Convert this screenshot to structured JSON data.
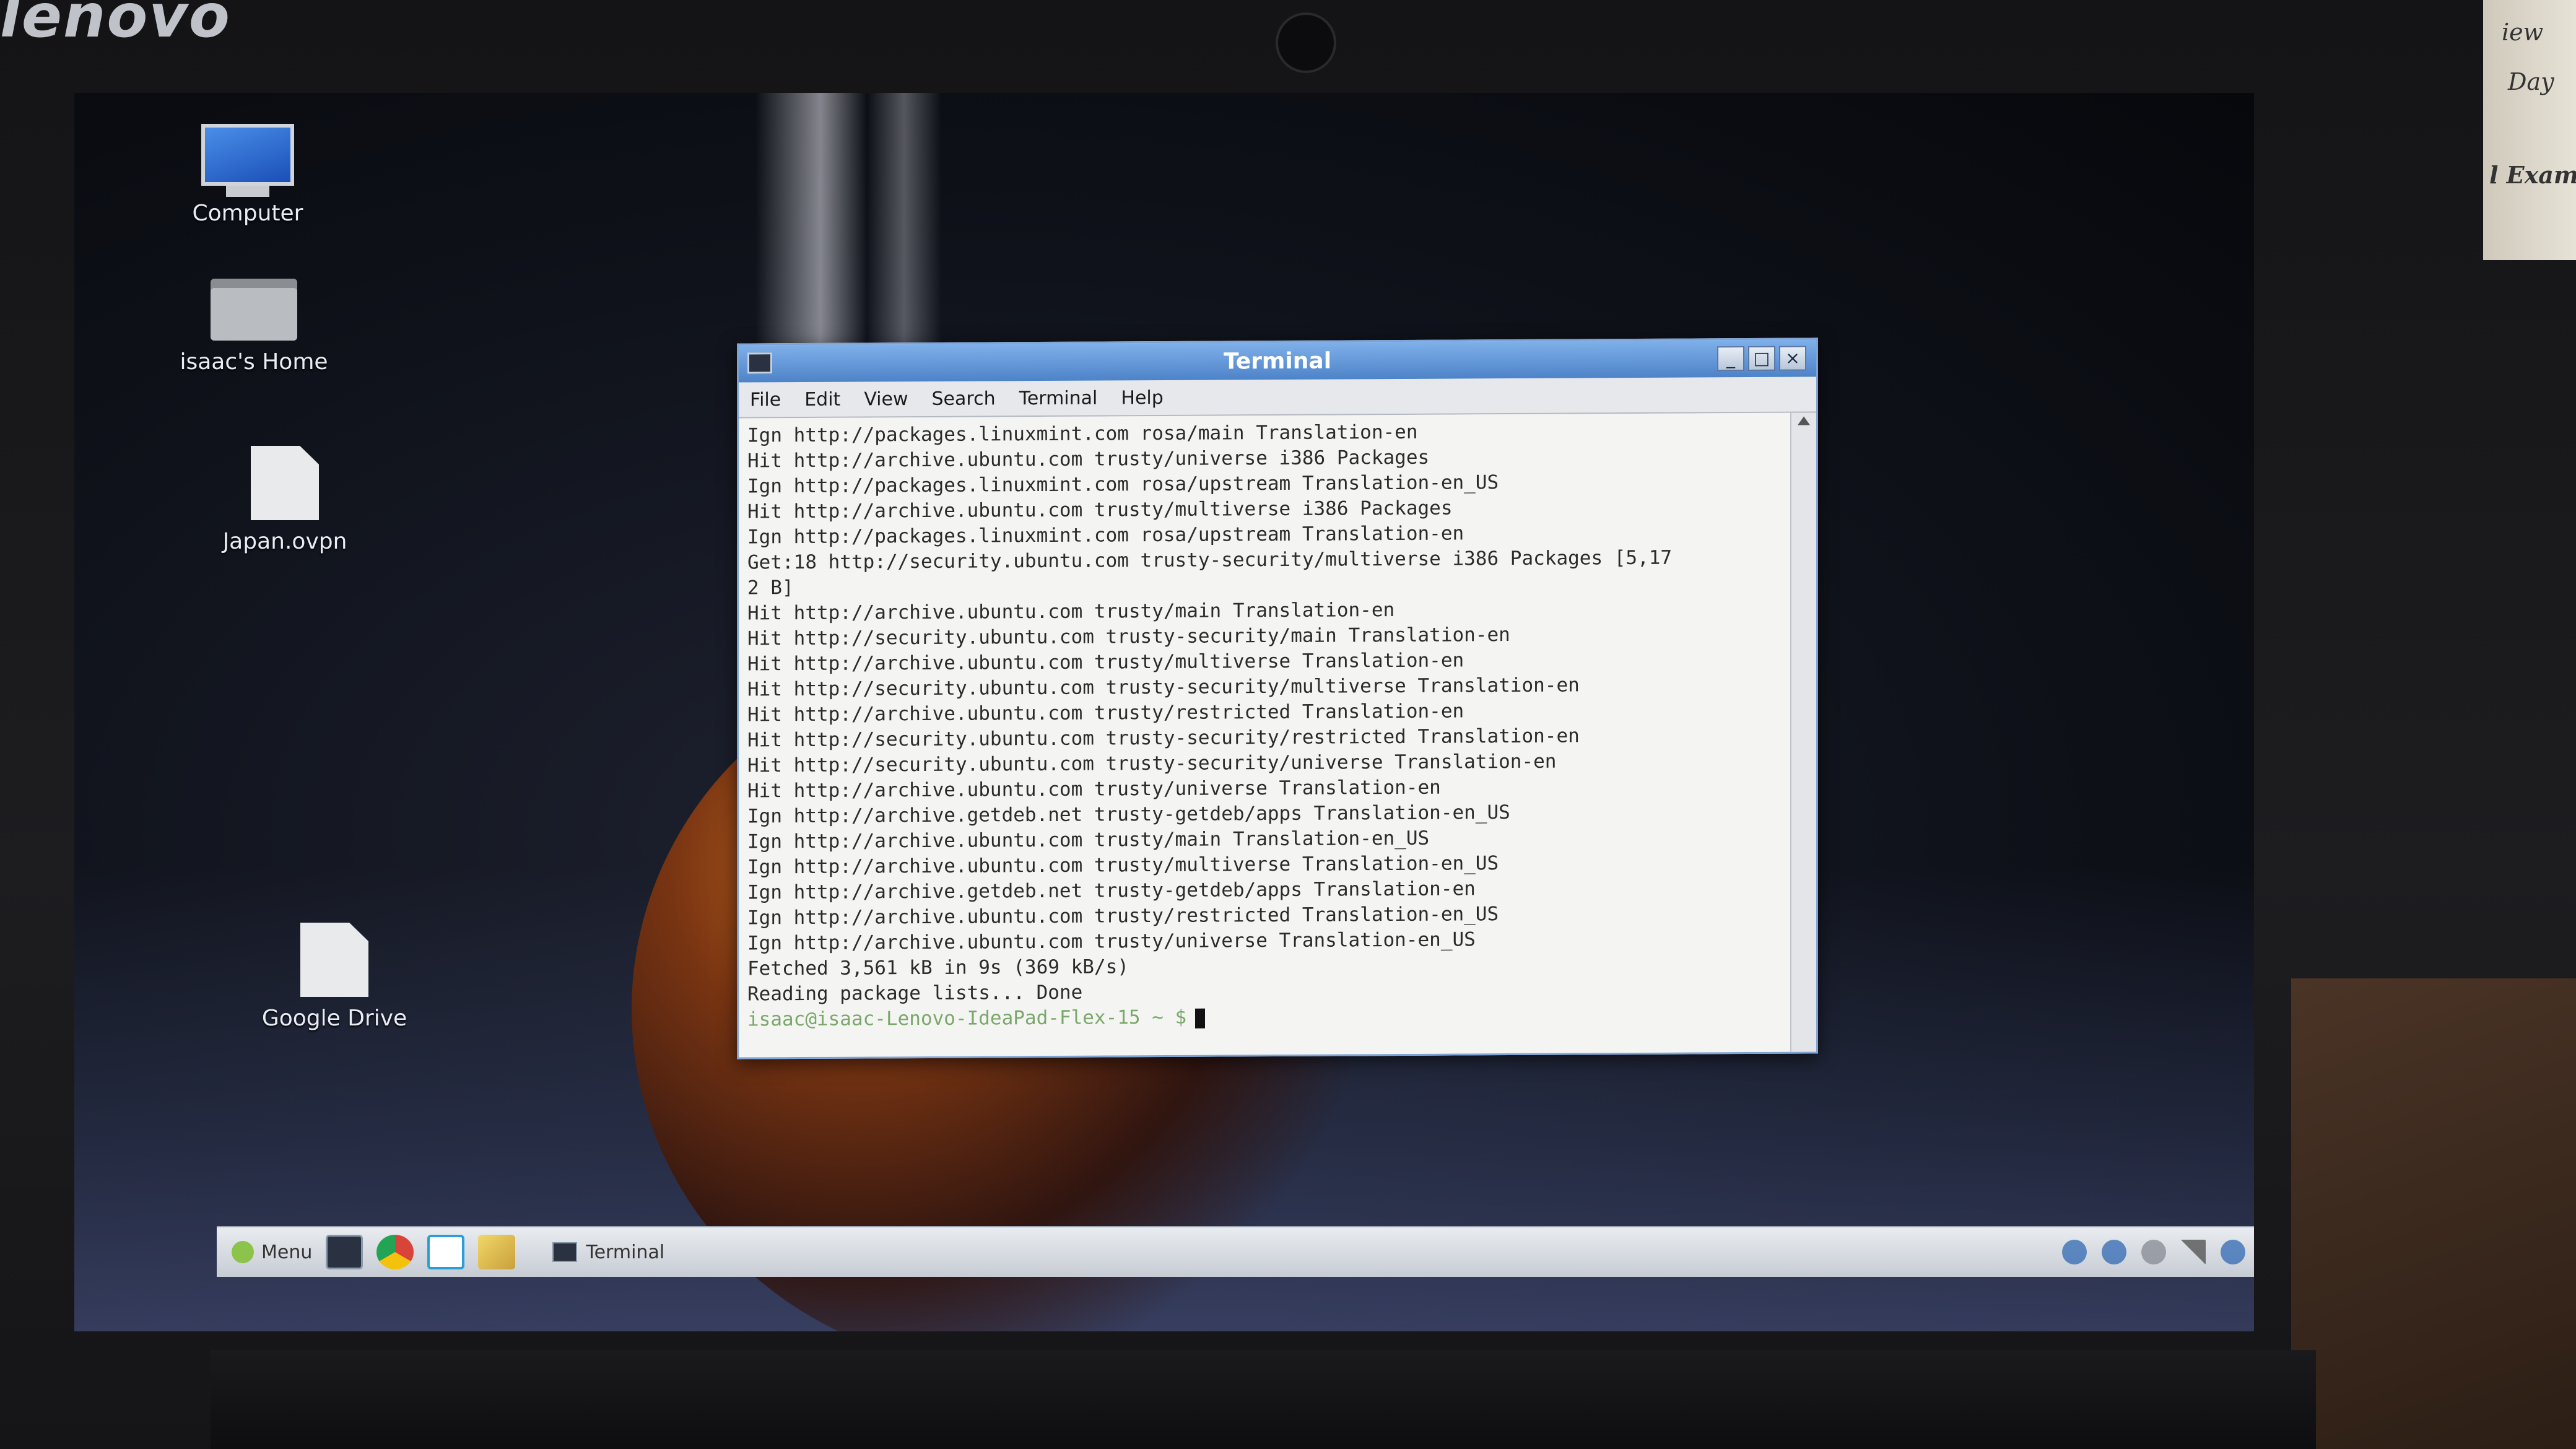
{
  "device": {
    "brand": "lenovo"
  },
  "background_paper": {
    "lines": [
      "iew",
      "Day",
      "l Exam!"
    ]
  },
  "desktop": {
    "icons": [
      {
        "label": "Computer",
        "icon": "computer-icon"
      },
      {
        "label": "isaac's Home",
        "icon": "home-folder-icon"
      },
      {
        "label": "Japan.ovpn",
        "icon": "file-icon"
      },
      {
        "label": "Google Drive",
        "icon": "file-icon"
      }
    ]
  },
  "terminal": {
    "title": "Terminal",
    "menu": [
      "File",
      "Edit",
      "View",
      "Search",
      "Terminal",
      "Help"
    ],
    "lines": [
      "Ign http://packages.linuxmint.com rosa/main Translation-en",
      "Hit http://archive.ubuntu.com trusty/universe i386 Packages",
      "Ign http://packages.linuxmint.com rosa/upstream Translation-en_US",
      "Hit http://archive.ubuntu.com trusty/multiverse i386 Packages",
      "Ign http://packages.linuxmint.com rosa/upstream Translation-en",
      "Get:18 http://security.ubuntu.com trusty-security/multiverse i386 Packages [5,17",
      "2 B]",
      "Hit http://archive.ubuntu.com trusty/main Translation-en",
      "Hit http://security.ubuntu.com trusty-security/main Translation-en",
      "Hit http://archive.ubuntu.com trusty/multiverse Translation-en",
      "Hit http://security.ubuntu.com trusty-security/multiverse Translation-en",
      "Hit http://archive.ubuntu.com trusty/restricted Translation-en",
      "Hit http://security.ubuntu.com trusty-security/restricted Translation-en",
      "Hit http://security.ubuntu.com trusty-security/universe Translation-en",
      "Hit http://archive.ubuntu.com trusty/universe Translation-en",
      "Ign http://archive.getdeb.net trusty-getdeb/apps Translation-en_US",
      "Ign http://archive.ubuntu.com trusty/main Translation-en_US",
      "Ign http://archive.ubuntu.com trusty/multiverse Translation-en_US",
      "Ign http://archive.getdeb.net trusty-getdeb/apps Translation-en",
      "Ign http://archive.ubuntu.com trusty/restricted Translation-en_US",
      "Ign http://archive.ubuntu.com trusty/universe Translation-en_US",
      "Fetched 3,561 kB in 9s (369 kB/s)",
      "Reading package lists... Done"
    ],
    "prompt": "isaac@isaac-Lenovo-IdeaPad-Flex-15 ~ $"
  },
  "taskbar": {
    "menu_label": "Menu",
    "launchers": [
      "terminal-launcher-icon",
      "chrome-icon",
      "brackets-icon",
      "map-icon"
    ],
    "task_label": "Terminal",
    "tray_icons": [
      "network-icon",
      "bluetooth-icon",
      "volume-icon",
      "signal-icon",
      "update-icon"
    ]
  },
  "colors": {
    "titlebar": "#4d83c8",
    "terminal_bg": "#f4f4f2",
    "prompt": "#7aa86a"
  }
}
